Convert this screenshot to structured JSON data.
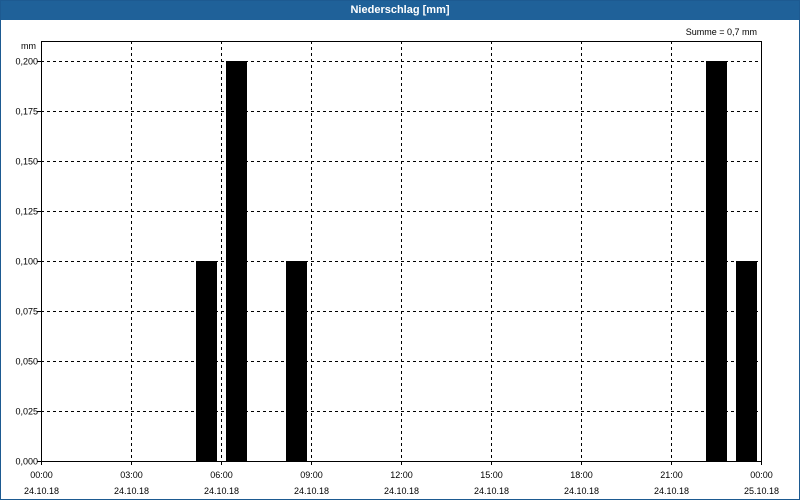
{
  "window": {
    "title": "Niederschlag [mm]"
  },
  "colors": {
    "title_bar": "#1f6199",
    "bar_fill": "#000000",
    "grid": "#000000"
  },
  "chart_data": {
    "type": "bar",
    "title": "Niederschlag [mm]",
    "unit_label": "mm",
    "annotation": "Summe = 0,7 mm",
    "x_range_hours": [
      0,
      24
    ],
    "ylim": [
      0,
      0.2
    ],
    "grid": "dashed",
    "y_ticks": [
      {
        "value": 0.0,
        "label": "0,000"
      },
      {
        "value": 0.025,
        "label": "0,025"
      },
      {
        "value": 0.05,
        "label": "0,050"
      },
      {
        "value": 0.075,
        "label": "0,075"
      },
      {
        "value": 0.1,
        "label": "0,100"
      },
      {
        "value": 0.125,
        "label": "0,125"
      },
      {
        "value": 0.15,
        "label": "0,150"
      },
      {
        "value": 0.175,
        "label": "0,175"
      },
      {
        "value": 0.2,
        "label": "0,200"
      }
    ],
    "x_ticks": [
      {
        "hour": 0,
        "time": "00:00",
        "date": "24.10.18"
      },
      {
        "hour": 3,
        "time": "03:00",
        "date": "24.10.18"
      },
      {
        "hour": 6,
        "time": "06:00",
        "date": "24.10.18"
      },
      {
        "hour": 9,
        "time": "09:00",
        "date": "24.10.18"
      },
      {
        "hour": 12,
        "time": "12:00",
        "date": "24.10.18"
      },
      {
        "hour": 15,
        "time": "15:00",
        "date": "24.10.18"
      },
      {
        "hour": 18,
        "time": "18:00",
        "date": "24.10.18"
      },
      {
        "hour": 21,
        "time": "21:00",
        "date": "24.10.18"
      },
      {
        "hour": 24,
        "time": "00:00",
        "date": "25.10.18"
      }
    ],
    "bars": [
      {
        "hour": 5.5,
        "value": 0.1
      },
      {
        "hour": 6.5,
        "value": 0.2
      },
      {
        "hour": 8.5,
        "value": 0.1
      },
      {
        "hour": 22.5,
        "value": 0.2
      },
      {
        "hour": 23.5,
        "value": 0.1
      }
    ]
  }
}
